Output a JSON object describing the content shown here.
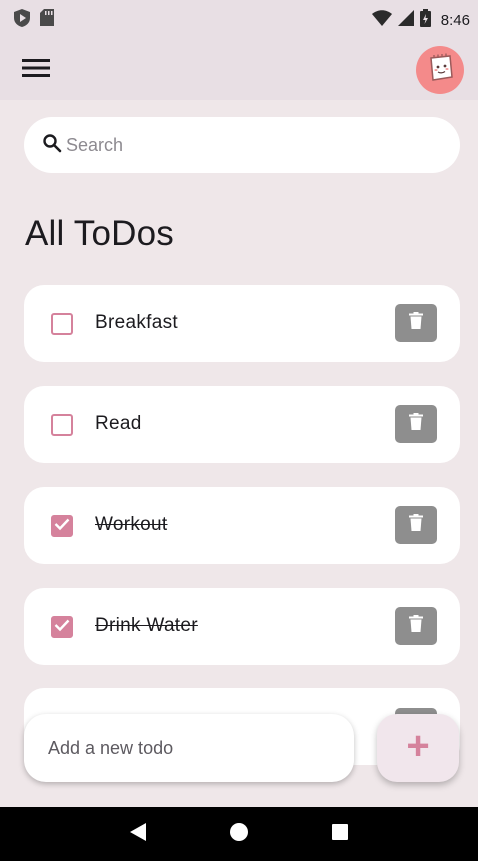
{
  "status_bar": {
    "time": "8:46",
    "icons": [
      "play-protect-icon",
      "sd-card-icon",
      "wifi-icon",
      "cell-signal-icon",
      "battery-icon"
    ]
  },
  "app_bar": {
    "menu_icon": "hamburger-menu-icon",
    "avatar_icon": "avatar-note-icon"
  },
  "search": {
    "placeholder": "Search",
    "value": ""
  },
  "page": {
    "title": "All ToDos"
  },
  "todos": [
    {
      "label": "Breakfast",
      "done": false
    },
    {
      "label": "Read",
      "done": false
    },
    {
      "label": "Workout",
      "done": true
    },
    {
      "label": "Drink Water",
      "done": true
    }
  ],
  "add_todo": {
    "placeholder": "Add a new todo",
    "value": "",
    "button_symbol": "+"
  },
  "colors": {
    "accent": "#d5829c",
    "background": "#efe7e9",
    "app_bar": "#e8dfe4",
    "delete_button": "#8e8e8e",
    "avatar_bg": "#f48a8a"
  }
}
